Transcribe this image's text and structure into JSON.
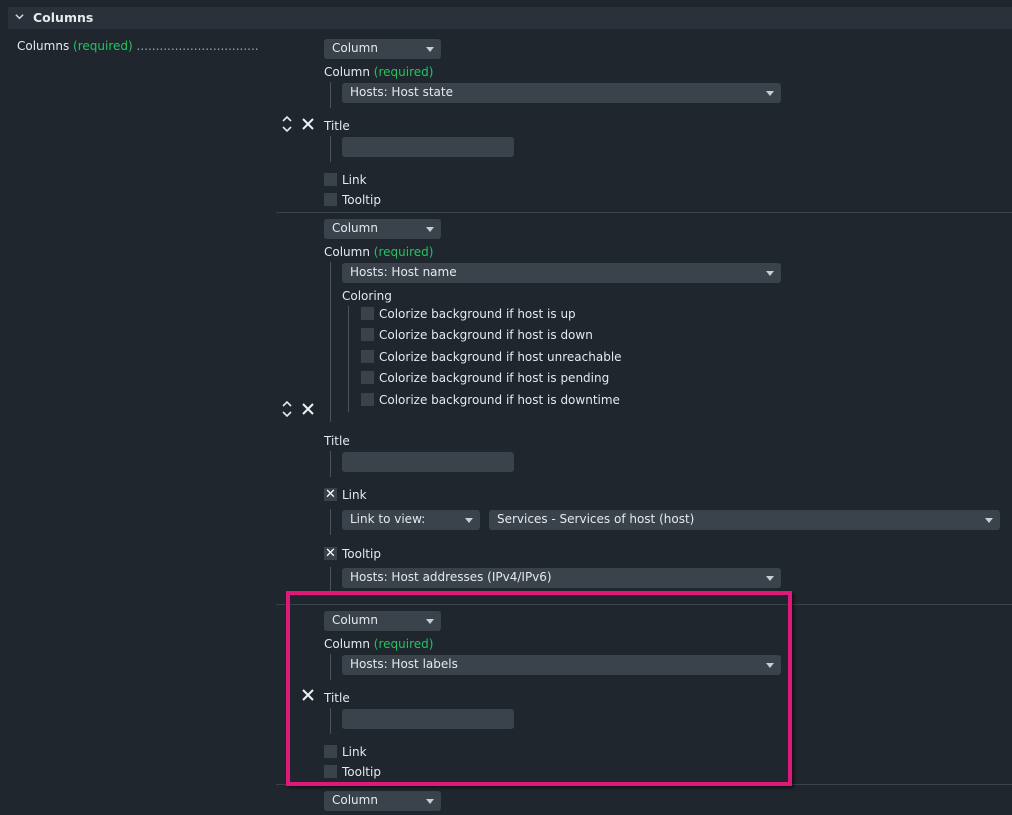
{
  "header": {
    "title": "Columns"
  },
  "left": {
    "label": "Columns",
    "required": "(required)",
    "dots": "................................"
  },
  "rows": [
    {
      "type_select": "Column",
      "column_label": "Column",
      "column_required": "(required)",
      "column_value": "Hosts: Host state",
      "title_label": "Title",
      "title_value": "",
      "link_label": "Link",
      "tooltip_label": "Tooltip"
    },
    {
      "type_select": "Column",
      "column_label": "Column",
      "column_required": "(required)",
      "column_value": "Hosts: Host name",
      "coloring_label": "Coloring",
      "coloring_options": [
        "Colorize background if host is up",
        "Colorize background if host is down",
        "Colorize background if host unreachable",
        "Colorize background if host is pending",
        "Colorize background if host is downtime"
      ],
      "title_label": "Title",
      "title_value": "",
      "link_label": "Link",
      "link_checked": true,
      "link_to_view": "Link to view:",
      "link_view_value": "Services - Services of host (host)",
      "tooltip_label": "Tooltip",
      "tooltip_checked": true,
      "tooltip_value": "Hosts: Host addresses (IPv4/IPv6)"
    },
    {
      "type_select": "Column",
      "column_label": "Column",
      "column_required": "(required)",
      "column_value": "Hosts: Host labels",
      "title_label": "Title",
      "title_value": "",
      "link_label": "Link",
      "tooltip_label": "Tooltip"
    },
    {
      "type_select": "Column"
    }
  ],
  "colors": {
    "background": "#1f262e",
    "field": "#3a424c",
    "required": "#22c55e",
    "highlight": "#e0187a"
  }
}
